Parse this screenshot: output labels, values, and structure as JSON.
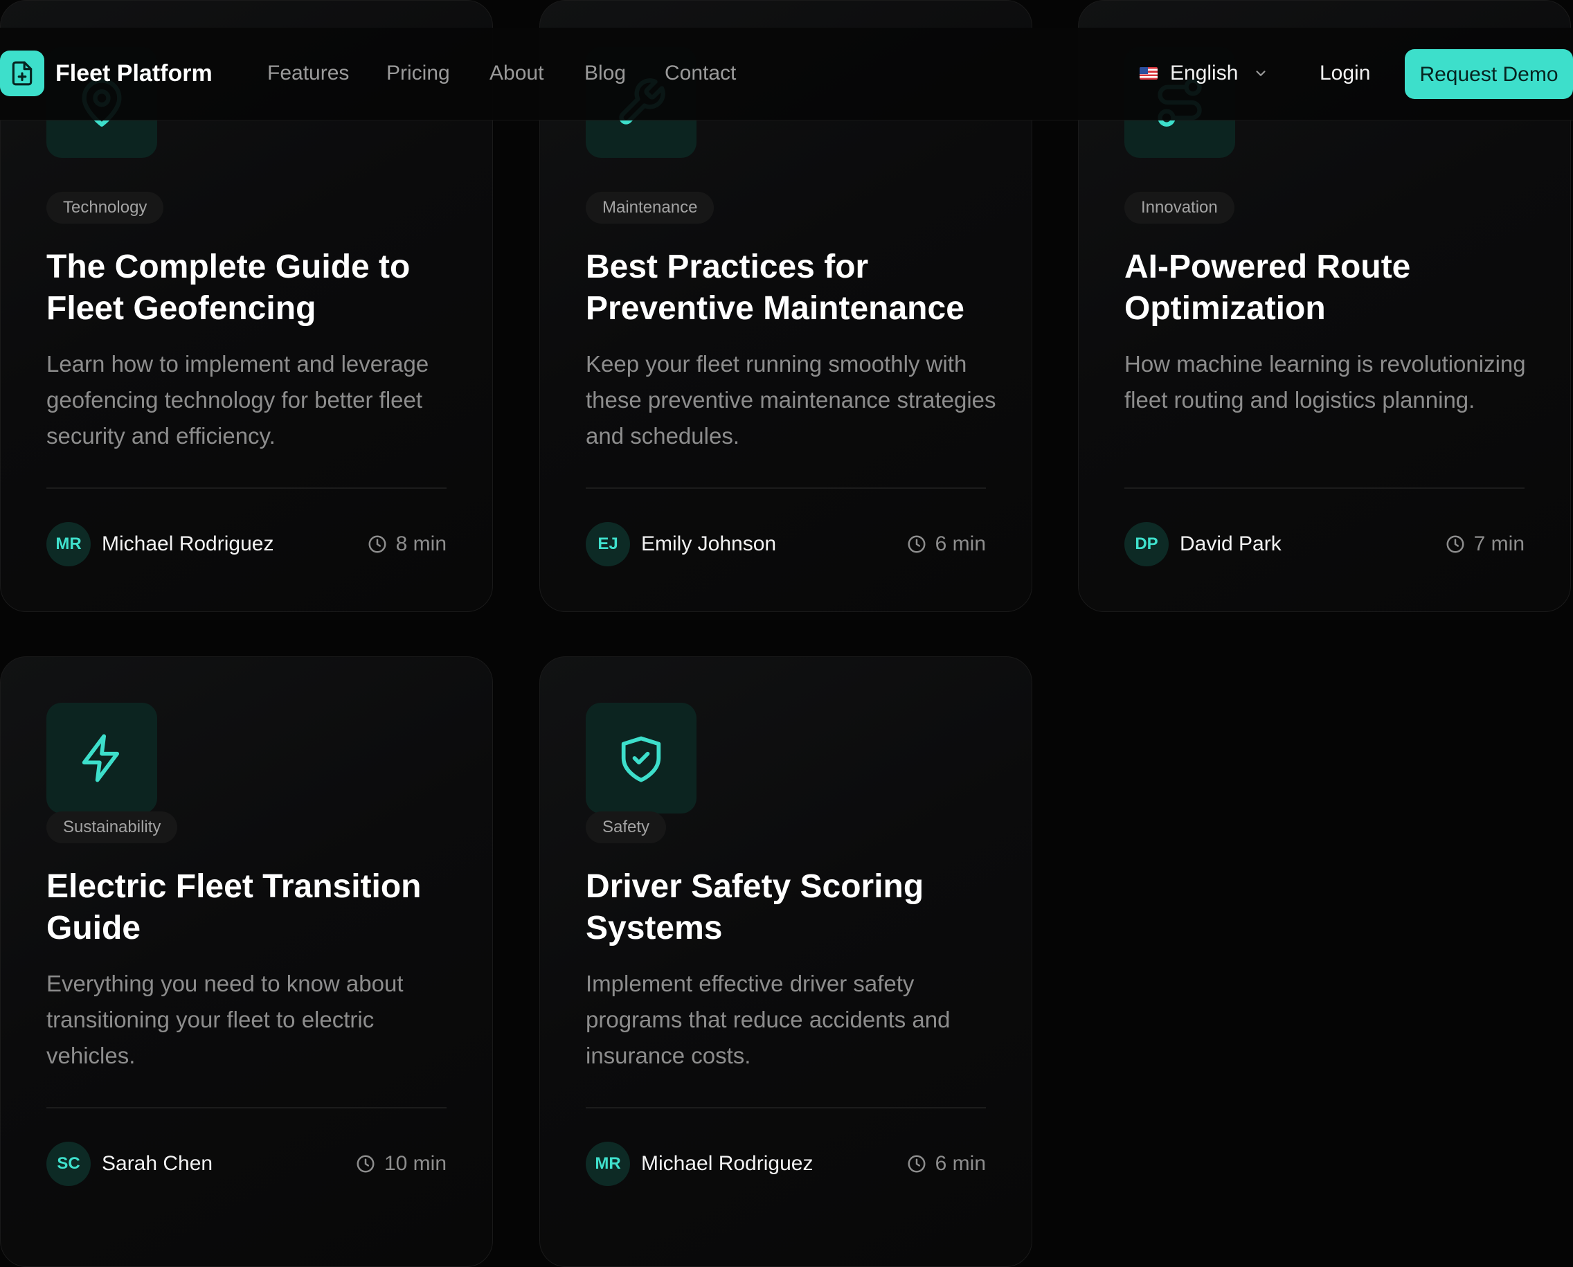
{
  "nav": {
    "brand": "Fleet Platform",
    "links": [
      "Features",
      "Pricing",
      "About",
      "Blog",
      "Contact"
    ],
    "language": "English",
    "login": "Login",
    "cta": "Request Demo"
  },
  "colors": {
    "accent": "#3ddfcb",
    "background": "#050505",
    "card": "#0e0e0f",
    "icon_bg": "#0c2420"
  },
  "posts": [
    {
      "icon": "map-pin-icon",
      "category": "Technology",
      "title": "The Complete Guide to Fleet Geofencing",
      "excerpt": "Learn how to implement and leverage geofencing technology for better fleet security and efficiency.",
      "author_initials": "MR",
      "author": "Michael Rodriguez",
      "read_time": "8 min"
    },
    {
      "icon": "wrench-icon",
      "category": "Maintenance",
      "title": "Best Practices for Preventive Maintenance",
      "excerpt": "Keep your fleet running smoothly with these preventive maintenance strategies and schedules.",
      "author_initials": "EJ",
      "author": "Emily Johnson",
      "read_time": "6 min"
    },
    {
      "icon": "route-icon",
      "category": "Innovation",
      "title": "AI-Powered Route Optimization",
      "excerpt": "How machine learning is revolutionizing fleet routing and logistics planning.",
      "author_initials": "DP",
      "author": "David Park",
      "read_time": "7 min"
    },
    {
      "icon": "lightning-icon",
      "category": "Sustainability",
      "title": "Electric Fleet Transition Guide",
      "excerpt": "Everything you need to know about transitioning your fleet to electric vehicles.",
      "author_initials": "SC",
      "author": "Sarah Chen",
      "read_time": "10 min"
    },
    {
      "icon": "shield-check-icon",
      "category": "Safety",
      "title": "Driver Safety Scoring Systems",
      "excerpt": "Implement effective driver safety programs that reduce accidents and insurance costs.",
      "author_initials": "MR",
      "author": "Michael Rodriguez",
      "read_time": "6 min"
    }
  ]
}
